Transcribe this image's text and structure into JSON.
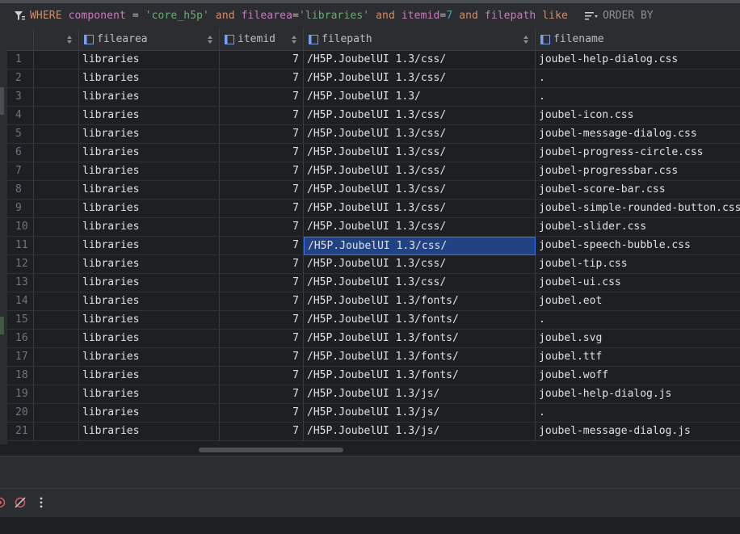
{
  "filter": {
    "where_keyword": "WHERE",
    "segments": [
      {
        "t": "col",
        "v": "component"
      },
      {
        "t": "txt",
        "v": " = "
      },
      {
        "t": "str",
        "v": "'core_h5p'"
      },
      {
        "t": "kw",
        "v": " and "
      },
      {
        "t": "col",
        "v": "filearea"
      },
      {
        "t": "txt",
        "v": "="
      },
      {
        "t": "str",
        "v": "'libraries'"
      },
      {
        "t": "kw",
        "v": " and "
      },
      {
        "t": "col",
        "v": "itemid"
      },
      {
        "t": "txt",
        "v": "="
      },
      {
        "t": "num",
        "v": "7"
      },
      {
        "t": "kw",
        "v": " and "
      },
      {
        "t": "col",
        "v": "filepath"
      },
      {
        "t": "kw",
        "v": " like"
      }
    ],
    "order_by_label": "ORDER BY"
  },
  "columns": [
    {
      "key": "blank",
      "label": ""
    },
    {
      "key": "filearea",
      "label": "filearea"
    },
    {
      "key": "itemid",
      "label": "itemid"
    },
    {
      "key": "filepath",
      "label": "filepath"
    },
    {
      "key": "filename",
      "label": "filename"
    }
  ],
  "rows": [
    {
      "n": "1",
      "filearea": "libraries",
      "itemid": "7",
      "filepath": "/H5P.JoubelUI 1.3/css/",
      "filename": "joubel-help-dialog.css"
    },
    {
      "n": "2",
      "filearea": "libraries",
      "itemid": "7",
      "filepath": "/H5P.JoubelUI 1.3/css/",
      "filename": "."
    },
    {
      "n": "3",
      "filearea": "libraries",
      "itemid": "7",
      "filepath": "/H5P.JoubelUI 1.3/",
      "filename": "."
    },
    {
      "n": "4",
      "filearea": "libraries",
      "itemid": "7",
      "filepath": "/H5P.JoubelUI 1.3/css/",
      "filename": "joubel-icon.css"
    },
    {
      "n": "5",
      "filearea": "libraries",
      "itemid": "7",
      "filepath": "/H5P.JoubelUI 1.3/css/",
      "filename": "joubel-message-dialog.css"
    },
    {
      "n": "6",
      "filearea": "libraries",
      "itemid": "7",
      "filepath": "/H5P.JoubelUI 1.3/css/",
      "filename": "joubel-progress-circle.css"
    },
    {
      "n": "7",
      "filearea": "libraries",
      "itemid": "7",
      "filepath": "/H5P.JoubelUI 1.3/css/",
      "filename": "joubel-progressbar.css"
    },
    {
      "n": "8",
      "filearea": "libraries",
      "itemid": "7",
      "filepath": "/H5P.JoubelUI 1.3/css/",
      "filename": "joubel-score-bar.css"
    },
    {
      "n": "9",
      "filearea": "libraries",
      "itemid": "7",
      "filepath": "/H5P.JoubelUI 1.3/css/",
      "filename": "joubel-simple-rounded-button.css"
    },
    {
      "n": "10",
      "filearea": "libraries",
      "itemid": "7",
      "filepath": "/H5P.JoubelUI 1.3/css/",
      "filename": "joubel-slider.css"
    },
    {
      "n": "11",
      "filearea": "libraries",
      "itemid": "7",
      "filepath": "/H5P.JoubelUI 1.3/css/",
      "filename": "joubel-speech-bubble.css",
      "selected": true
    },
    {
      "n": "12",
      "filearea": "libraries",
      "itemid": "7",
      "filepath": "/H5P.JoubelUI 1.3/css/",
      "filename": "joubel-tip.css"
    },
    {
      "n": "13",
      "filearea": "libraries",
      "itemid": "7",
      "filepath": "/H5P.JoubelUI 1.3/css/",
      "filename": "joubel-ui.css"
    },
    {
      "n": "14",
      "filearea": "libraries",
      "itemid": "7",
      "filepath": "/H5P.JoubelUI 1.3/fonts/",
      "filename": "joubel.eot"
    },
    {
      "n": "15",
      "filearea": "libraries",
      "itemid": "7",
      "filepath": "/H5P.JoubelUI 1.3/fonts/",
      "filename": "."
    },
    {
      "n": "16",
      "filearea": "libraries",
      "itemid": "7",
      "filepath": "/H5P.JoubelUI 1.3/fonts/",
      "filename": "joubel.svg"
    },
    {
      "n": "17",
      "filearea": "libraries",
      "itemid": "7",
      "filepath": "/H5P.JoubelUI 1.3/fonts/",
      "filename": "joubel.ttf"
    },
    {
      "n": "18",
      "filearea": "libraries",
      "itemid": "7",
      "filepath": "/H5P.JoubelUI 1.3/fonts/",
      "filename": "joubel.woff"
    },
    {
      "n": "19",
      "filearea": "libraries",
      "itemid": "7",
      "filepath": "/H5P.JoubelUI 1.3/js/",
      "filename": "joubel-help-dialog.js"
    },
    {
      "n": "20",
      "filearea": "libraries",
      "itemid": "7",
      "filepath": "/H5P.JoubelUI 1.3/js/",
      "filename": "."
    },
    {
      "n": "21",
      "filearea": "libraries",
      "itemid": "7",
      "filepath": "/H5P.JoubelUI 1.3/js/",
      "filename": "joubel-message-dialog.js"
    }
  ],
  "colors": {
    "selection": "#214283",
    "keyword": "#cf8e6d",
    "string": "#6aab73",
    "number": "#2aacb8",
    "column": "#c77dbb"
  },
  "toolbar": {
    "icons": [
      "breakpoint-icon",
      "mute-breakpoints-icon",
      "more-options-icon"
    ]
  }
}
